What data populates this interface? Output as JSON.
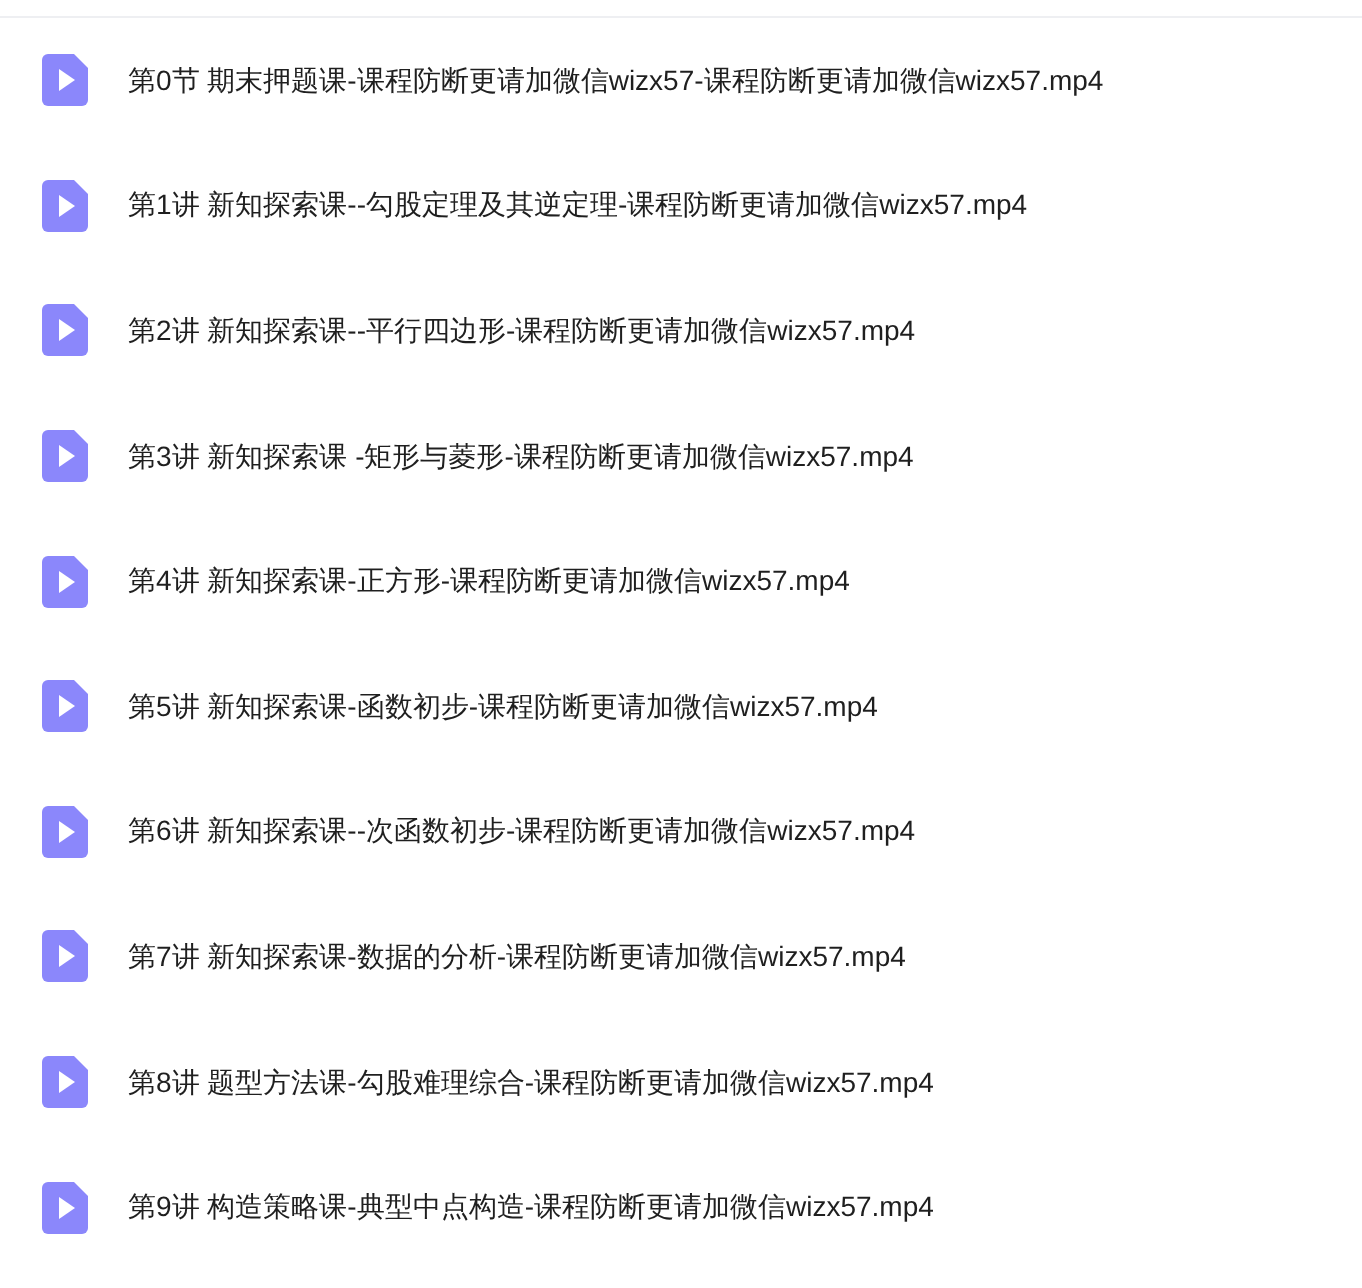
{
  "files": [
    {
      "name": "第0节 期末押题课-课程防断更请加微信wizx57-课程防断更请加微信wizx57.mp4"
    },
    {
      "name": "第1讲 新知探索课--勾股定理及其逆定理-课程防断更请加微信wizx57.mp4"
    },
    {
      "name": "第2讲 新知探索课--平行四边形-课程防断更请加微信wizx57.mp4"
    },
    {
      "name": "第3讲 新知探索课 -矩形与菱形-课程防断更请加微信wizx57.mp4"
    },
    {
      "name": "第4讲 新知探索课-正方形-课程防断更请加微信wizx57.mp4"
    },
    {
      "name": "第5讲 新知探索课-函数初步-课程防断更请加微信wizx57.mp4"
    },
    {
      "name": "第6讲 新知探索课--次函数初步-课程防断更请加微信wizx57.mp4"
    },
    {
      "name": "第7讲 新知探索课-数据的分析-课程防断更请加微信wizx57.mp4"
    },
    {
      "name": "第8讲 题型方法课-勾股难理综合-课程防断更请加微信wizx57.mp4"
    },
    {
      "name": "第9讲 构造策略课-典型中点构造-课程防断更请加微信wizx57.mp4"
    }
  ]
}
